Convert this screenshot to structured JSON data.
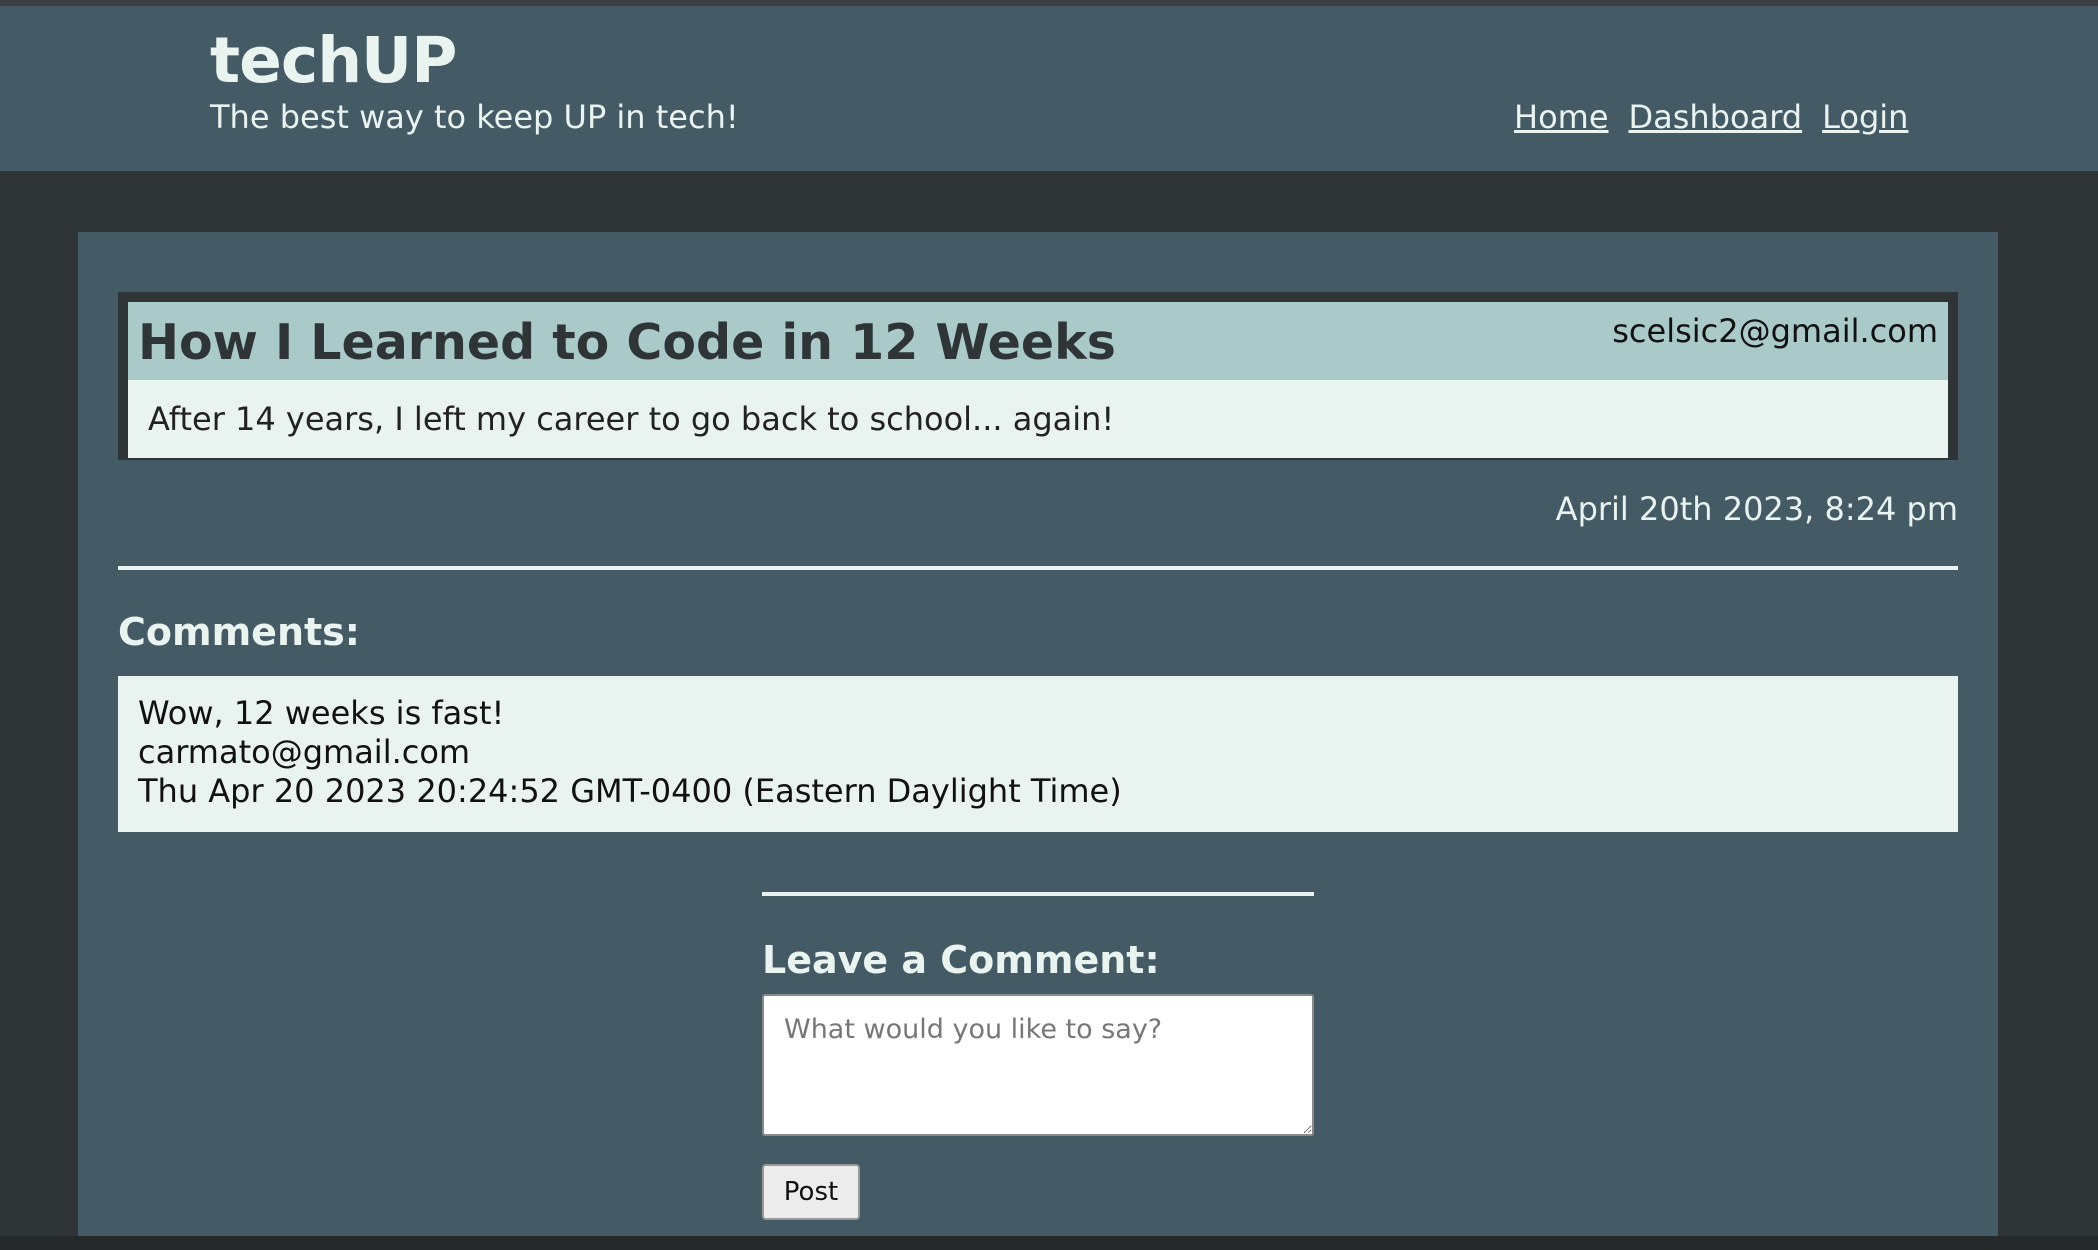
{
  "header": {
    "title": "techUP",
    "tagline": "The best way to keep UP in tech!",
    "nav": [
      {
        "label": "Home"
      },
      {
        "label": "Dashboard"
      },
      {
        "label": "Login"
      }
    ]
  },
  "post": {
    "title": "How I Learned to Code in 12 Weeks",
    "author": "scelsic2@gmail.com",
    "body": "After 14 years, I left my career to go back to school... again!",
    "date": "April 20th 2023, 8:24 pm"
  },
  "comments": {
    "heading": "Comments:",
    "items": [
      {
        "text": "Wow, 12 weeks is fast!",
        "author": "carmato@gmail.com",
        "date": "Thu Apr 20 2023 20:24:52 GMT-0400 (Eastern Daylight Time)"
      }
    ]
  },
  "comment_form": {
    "heading": "Leave a Comment:",
    "placeholder": "What would you like to say?",
    "value": "",
    "submit_label": "Post"
  },
  "colors": {
    "background": "#2f3536",
    "panel": "#445b66",
    "title_bar": "#aac9c9",
    "light_card": "#e9f3f0"
  }
}
